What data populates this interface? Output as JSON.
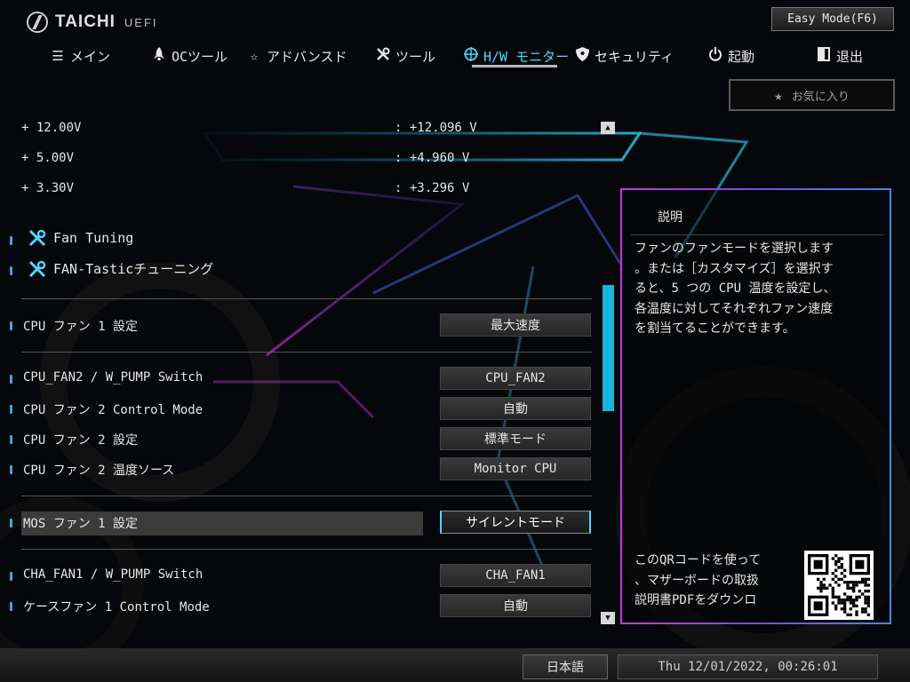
{
  "header": {
    "logo_text": "TAICHI",
    "logo_sub": "UEFI",
    "easy_mode_label": "Easy Mode(F6)",
    "favorite_label": "お気に入り"
  },
  "nav": {
    "tabs": [
      {
        "label": "メイン",
        "icon": "list-icon"
      },
      {
        "label": "OCツール",
        "icon": "rocket-icon"
      },
      {
        "label": "アドバンスド",
        "icon": "star-outline-icon"
      },
      {
        "label": "ツール",
        "icon": "tools-icon"
      },
      {
        "label": "H/W モニター",
        "icon": "monitor-target-icon",
        "active": true
      },
      {
        "label": "セキュリティ",
        "icon": "shield-icon"
      },
      {
        "label": "起動",
        "icon": "power-icon"
      },
      {
        "label": "退出",
        "icon": "exit-icon"
      }
    ]
  },
  "voltages": [
    {
      "label": "+ 12.00V",
      "value": ": +12.096 V"
    },
    {
      "label": "+ 5.00V",
      "value": ": +4.960 V"
    },
    {
      "label": "+ 3.30V",
      "value": ": +3.296 V"
    }
  ],
  "tools": [
    {
      "label": "Fan Tuning"
    },
    {
      "label": "FAN-Tasticチューニング"
    }
  ],
  "settings": [
    {
      "label": "CPU ファン 1 設定",
      "value": "最大速度"
    },
    {
      "label": "CPU_FAN2 / W_PUMP Switch",
      "value": "CPU_FAN2"
    },
    {
      "label": "CPU ファン 2 Control Mode",
      "value": "自動"
    },
    {
      "label": "CPU ファン 2 設定",
      "value": "標準モード"
    },
    {
      "label": "CPU ファン 2 温度ソース",
      "value": "Monitor CPU"
    },
    {
      "label": "MOS ファン 1 設定",
      "value": "サイレントモード",
      "selected": true
    },
    {
      "label": "CHA_FAN1 / W_PUMP Switch",
      "value": "CHA_FAN1"
    },
    {
      "label": "ケースファン 1 Control Mode",
      "value": "自動"
    }
  ],
  "description": {
    "title": "説明",
    "text": "ファンのファンモードを選択します\n。または［カスタマイズ］を選択す\nると、5 つの CPU 温度を設定し、\n各温度に対してそれぞれファン速度\nを割当てることができます。",
    "qr_text": "このQRコードを使って\n、マザーボードの取扱\n説明書PDFをダウンロ"
  },
  "footer": {
    "language": "日本語",
    "datetime": "Thu 12/01/2022, 00:26:01"
  },
  "colors": {
    "accent": "#4fd7ff",
    "scroll_thumb": "#1ab4de",
    "panel_border_start": "#c43bd9",
    "panel_border_end": "#3c8cf0"
  }
}
